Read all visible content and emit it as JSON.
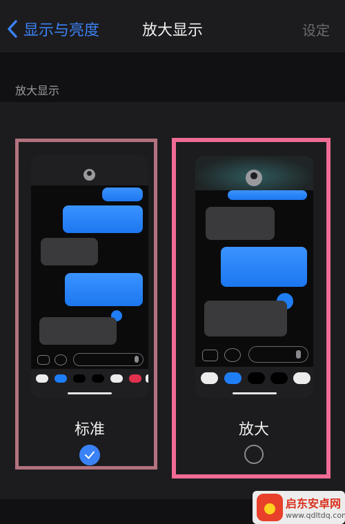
{
  "nav": {
    "back_label": "显示与亮度",
    "title": "放大显示",
    "right_label": "设定"
  },
  "section": {
    "label": "放大显示"
  },
  "options": [
    {
      "label": "标准",
      "selected": true
    },
    {
      "label": "放大",
      "selected": false
    }
  ],
  "watermark": {
    "title": "启东安卓网",
    "url": "www.qdltdq.com"
  },
  "colors": {
    "accent": "#3b82f6",
    "bubble_blue": "#1c77f0",
    "frame_left": "#b3727f",
    "frame_right": "#f06b96",
    "watermark_red": "#d9321e"
  }
}
